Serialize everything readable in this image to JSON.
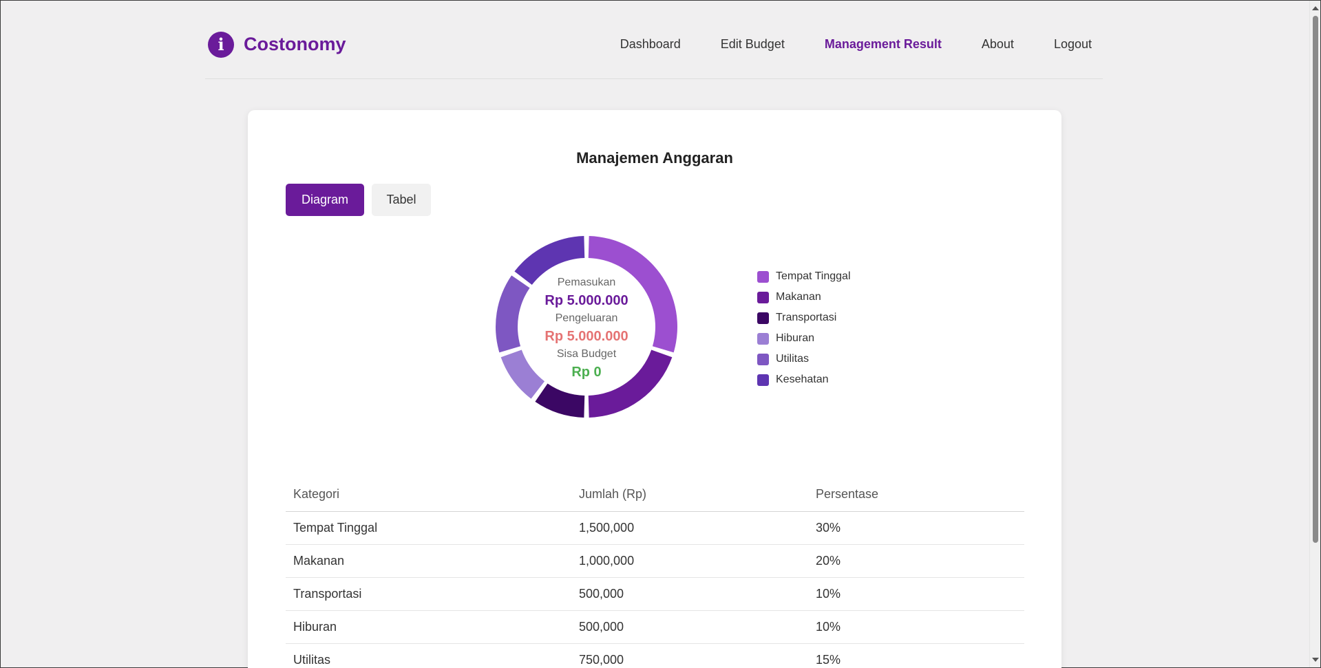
{
  "brand": {
    "name": "Costonomy",
    "icon": "info-icon",
    "icon_glyph": "i"
  },
  "nav": {
    "items": [
      {
        "label": "Dashboard",
        "active": false
      },
      {
        "label": "Edit Budget",
        "active": false
      },
      {
        "label": "Management Result",
        "active": true
      },
      {
        "label": "About",
        "active": false
      },
      {
        "label": "Logout",
        "active": false
      }
    ]
  },
  "card": {
    "title": "Manajemen Anggaran",
    "tabs": [
      {
        "label": "Diagram",
        "active": true
      },
      {
        "label": "Tabel",
        "active": false
      }
    ]
  },
  "summary": {
    "income_label": "Pemasukan",
    "income_value": "Rp 5.000.000",
    "expense_label": "Pengeluaran",
    "expense_value": "Rp 5.000.000",
    "remaining_label": "Sisa Budget",
    "remaining_value": "Rp 0"
  },
  "chart_data": {
    "type": "pie",
    "categories": [
      "Tempat Tinggal",
      "Makanan",
      "Transportasi",
      "Hiburan",
      "Utilitas",
      "Kesehatan"
    ],
    "values": [
      30,
      20,
      10,
      10,
      15,
      15
    ],
    "colors": [
      "#9c4fd0",
      "#6a1b9a",
      "#3b0764",
      "#9b7fd4",
      "#7e57c2",
      "#5e35b1"
    ]
  },
  "table": {
    "headers": [
      "Kategori",
      "Jumlah (Rp)",
      "Persentase"
    ],
    "rows": [
      [
        "Tempat Tinggal",
        "1,500,000",
        "30%"
      ],
      [
        "Makanan",
        "1,000,000",
        "20%"
      ],
      [
        "Transportasi",
        "500,000",
        "10%"
      ],
      [
        "Hiburan",
        "500,000",
        "10%"
      ],
      [
        "Utilitas",
        "750,000",
        "15%"
      ]
    ]
  }
}
